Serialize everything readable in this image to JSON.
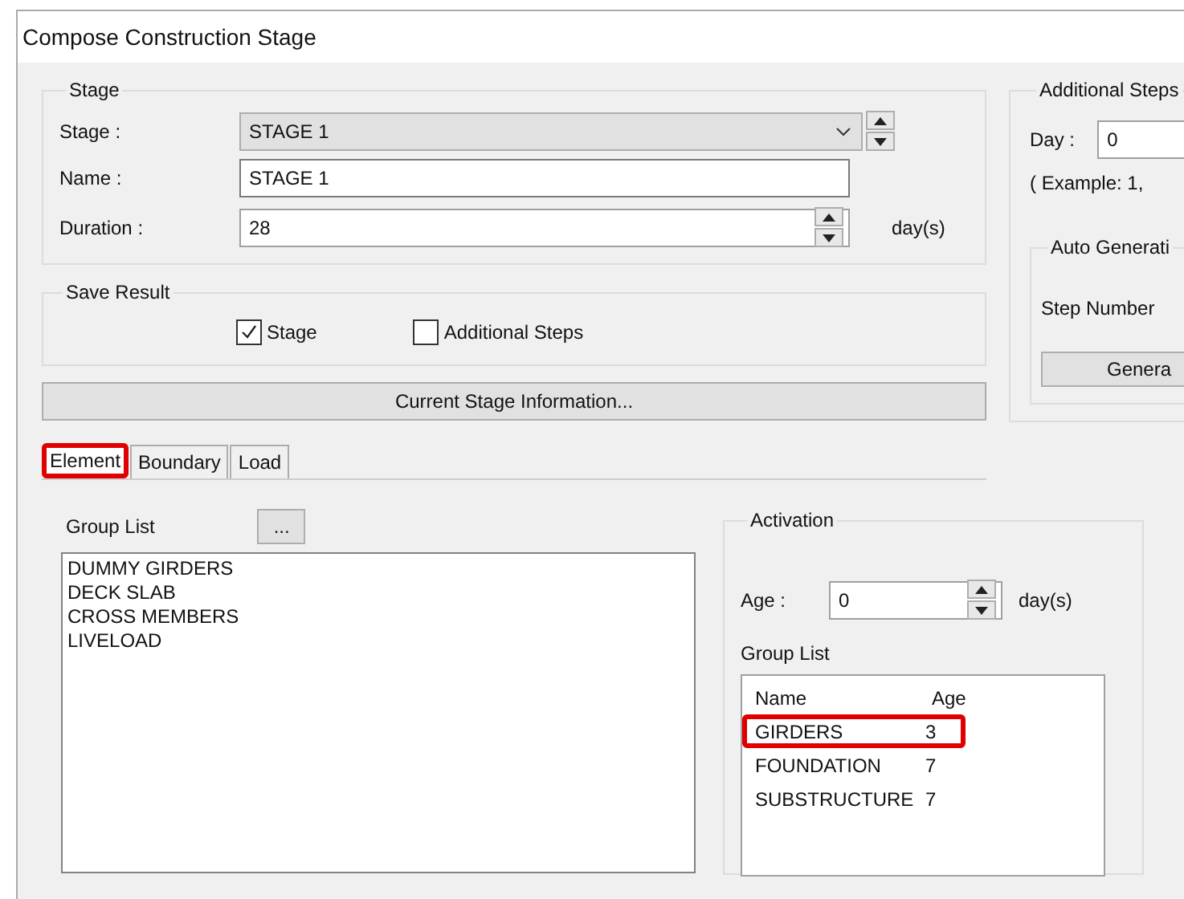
{
  "window": {
    "title": "Compose Construction Stage"
  },
  "stage_group": {
    "title": "Stage",
    "stage_label": "Stage :",
    "stage_value": "STAGE 1",
    "name_label": "Name :",
    "name_value": "STAGE 1",
    "duration_label": "Duration :",
    "duration_value": "28",
    "duration_unit": "day(s)"
  },
  "save_result": {
    "title": "Save Result",
    "options": [
      {
        "label": "Stage",
        "checked": true
      },
      {
        "label": "Additional Steps",
        "checked": false
      }
    ]
  },
  "info_button": "Current Stage Information...",
  "tabs": [
    {
      "label": "Element",
      "selected": true,
      "highlighted": true
    },
    {
      "label": "Boundary",
      "selected": false,
      "highlighted": false
    },
    {
      "label": "Load",
      "selected": false,
      "highlighted": false
    }
  ],
  "group_list": {
    "label": "Group List",
    "browse_button": "...",
    "items": [
      "DUMMY GIRDERS",
      "DECK SLAB",
      "CROSS MEMBERS",
      "LIVELOAD"
    ]
  },
  "activation": {
    "title": "Activation",
    "age_label": "Age  :",
    "age_value": "0",
    "age_unit": "day(s)",
    "list_label": "Group List",
    "columns": [
      "Name",
      "Age"
    ],
    "rows": [
      {
        "name": "GIRDERS",
        "age": "3",
        "highlighted": true
      },
      {
        "name": "FOUNDATION",
        "age": "7",
        "highlighted": false
      },
      {
        "name": "SUBSTRUCTURE",
        "age": "7",
        "highlighted": false
      }
    ]
  },
  "additional_steps": {
    "title": "Additional Steps",
    "day_label": "Day :",
    "day_value": "0",
    "example": "( Example: 1,",
    "auto_title": "Auto Generati",
    "step_label": "Step Number",
    "generate_button": "Genera"
  }
}
